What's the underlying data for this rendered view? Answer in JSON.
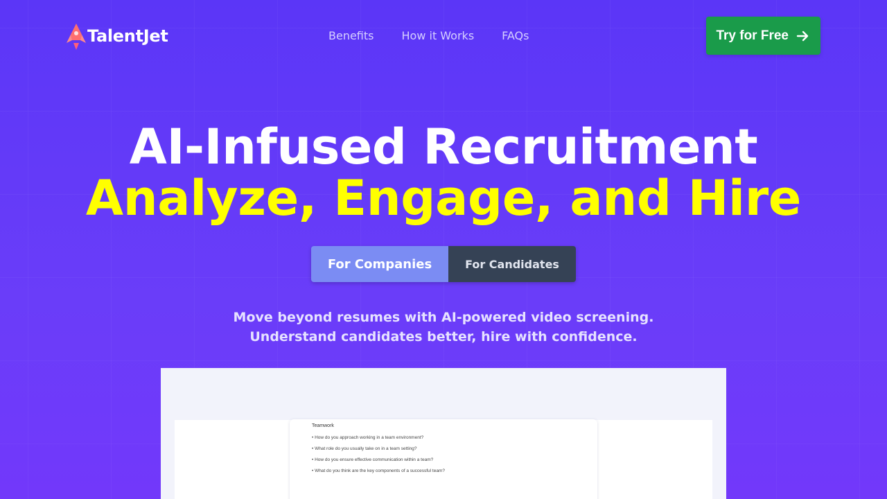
{
  "header": {
    "logo_text": "TalentJet",
    "nav": [
      "Benefits",
      "How it Works",
      "FAQs"
    ],
    "cta_label": "Try for Free"
  },
  "hero": {
    "line1": "AI-Infused Recruitment",
    "line2": "Analyze, Engage, and Hire",
    "toggle": {
      "active": "For Companies",
      "inactive": "For Candidates"
    },
    "subtitle_line1": "Move beyond resumes with AI-powered video screening.",
    "subtitle_line2": "Understand candidates better, hire with confidence."
  },
  "preview": {
    "card_title": "Teamwork",
    "questions": [
      "• How do you approach working in a team environment?",
      "• What role do you usually take on in a team setting?",
      "• How do you ensure effective communication within a team?",
      "• What do you think are the key components of a successful team?"
    ]
  },
  "colors": {
    "background": "#5b36f7",
    "headline_accent": "#ffff00",
    "cta": "#1a9b4a",
    "toggle_active": "#7b8cf3",
    "toggle_inactive": "#354255"
  },
  "icons": {
    "logo": "rocket-icon",
    "cta": "arrow-right-icon"
  }
}
